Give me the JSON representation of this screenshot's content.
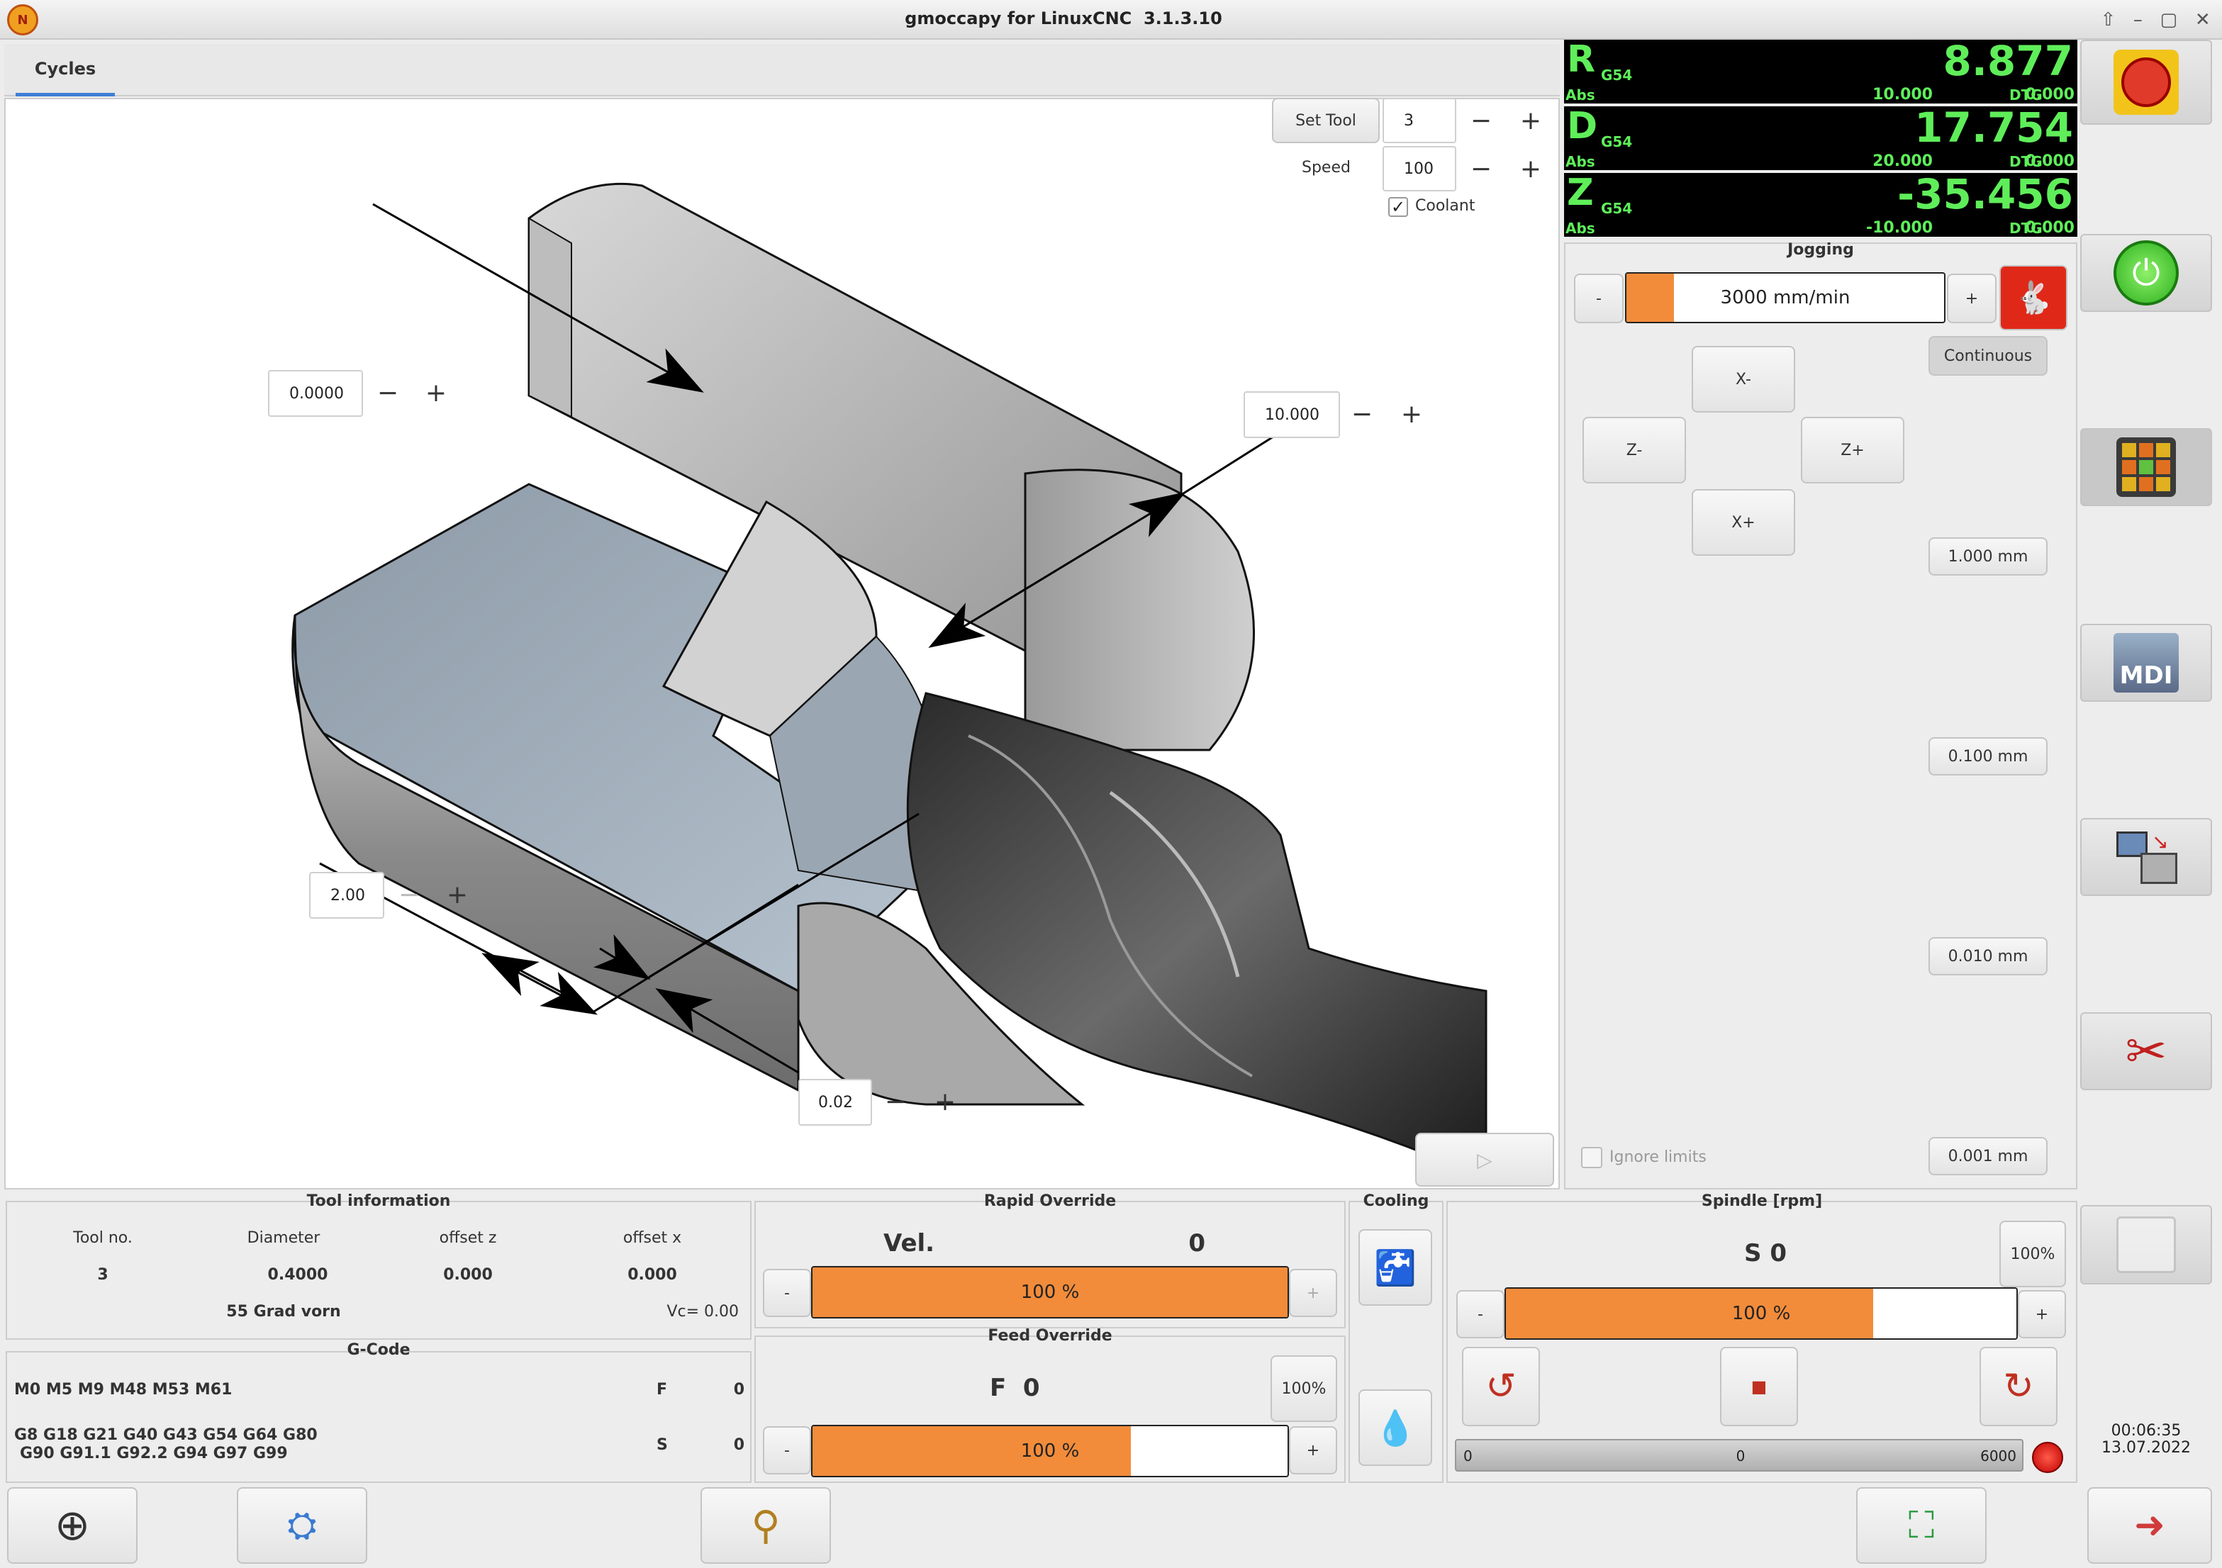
{
  "window": {
    "title": "gmoccapy for LinuxCNC  3.1.3.10"
  },
  "tabs": [
    {
      "label": "Cycles"
    }
  ],
  "cycle": {
    "set_tool_label": "Set Tool",
    "tool_value": "3",
    "speed_label": "Speed",
    "speed_value": "100",
    "coolant_label": "Coolant",
    "coolant_checked": true,
    "field_top_left": "0.0000",
    "field_top_right": "10.000",
    "field_bottom_left": "2.00",
    "field_bottom_mid": "0.02"
  },
  "dro": {
    "axes": [
      {
        "axis": "R",
        "cs": "G54",
        "value": "8.877",
        "abs_label": "Abs",
        "abs": "10.000",
        "dtg_label": "DTG",
        "dtg": "0.000"
      },
      {
        "axis": "D",
        "cs": "G54",
        "value": "17.754",
        "abs_label": "Abs",
        "abs": "20.000",
        "dtg_label": "DTG",
        "dtg": "0.000"
      },
      {
        "axis": "Z",
        "cs": "G54",
        "value": "-35.456",
        "abs_label": "Abs",
        "abs": "-10.000",
        "dtg_label": "DTG",
        "dtg": "0.000"
      }
    ]
  },
  "jogging": {
    "title": "Jogging",
    "minus": "-",
    "plus": "+",
    "speed_text": "3000 mm/min",
    "speed_fraction": 0.15,
    "continuous": "Continuous",
    "x_minus": "X-",
    "x_plus": "X+",
    "z_minus": "Z-",
    "z_plus": "Z+",
    "increments": [
      "1.000 mm",
      "0.100 mm",
      "0.010 mm",
      "0.001 mm"
    ],
    "ignore_limits": "Ignore limits"
  },
  "tool_info": {
    "title": "Tool information",
    "headers": [
      "Tool no.",
      "Diameter",
      "offset z",
      "offset x"
    ],
    "values": [
      "3",
      "0.4000",
      "0.000",
      "0.000"
    ],
    "description": "55 Grad vorn",
    "vc": "Vc= 0.00"
  },
  "gcode": {
    "title": "G-Code",
    "mcodes": "M0 M5 M9 M48 M53 M61",
    "gcodes_line1": "G8 G18 G21 G40 G43 G54 G64 G80",
    "gcodes_line2": "G90 G91.1 G92.2 G94 G97 G99",
    "f_label": "F",
    "f_value": "0",
    "s_label": "S",
    "s_value": "0"
  },
  "rapid": {
    "title": "Rapid Override",
    "vel_label": "Vel.",
    "vel_value": "0",
    "minus": "-",
    "plus": "+",
    "bar_text": "100 %",
    "fraction": 1.0
  },
  "feed": {
    "title": "Feed Override",
    "f_text": "F  0",
    "reset": "100%",
    "minus": "-",
    "plus": "+",
    "bar_text": "100 %",
    "fraction": 0.67
  },
  "cooling": {
    "title": "Cooling"
  },
  "spindle": {
    "title": "Spindle [rpm]",
    "s_text": "S 0",
    "reset": "100%",
    "minus": "-",
    "plus": "+",
    "bar_text": "100 %",
    "fraction": 0.72,
    "gauge_min": "0",
    "gauge_mid": "0",
    "gauge_max": "6000"
  },
  "status": {
    "time": "00:06:35",
    "date": "13.07.2022"
  },
  "colors": {
    "accent": "#f28c3a",
    "dro_green": "#5fee5a",
    "estop_red": "#e03a2a"
  }
}
